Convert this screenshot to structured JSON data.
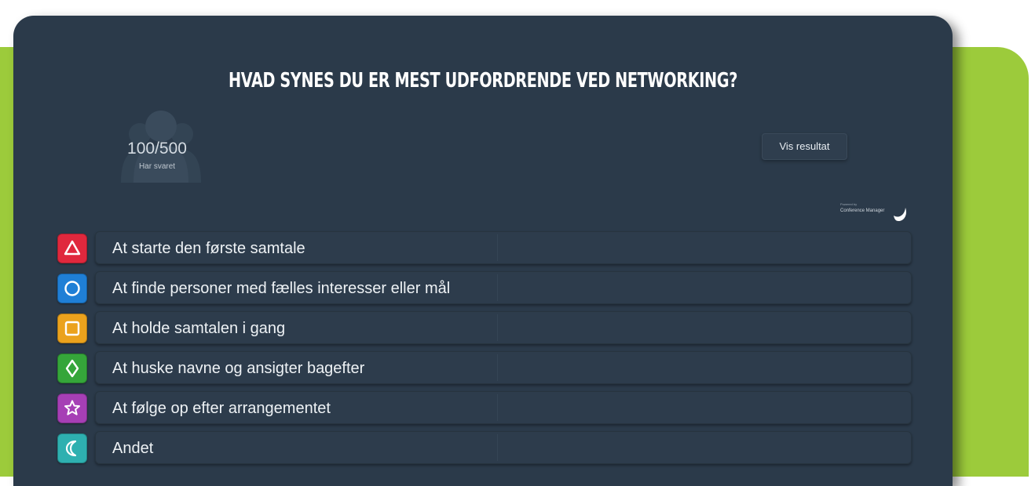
{
  "question": {
    "title": "HVAD SYNES DU ER MEST UDFORDRENDE VED NETWORKING?"
  },
  "stats": {
    "count": "100/500",
    "label": "Har svaret"
  },
  "actions": {
    "show_results": "Vis resultat"
  },
  "branding": {
    "powered_by": "Powered by",
    "product": "Conference Manager"
  },
  "colors": {
    "accent_green": "#9ccb3b",
    "panel": "#2b3a4a"
  },
  "answers": [
    {
      "label": "At starte den første samtale",
      "icon": "triangle-icon",
      "color": "#e0283d"
    },
    {
      "label": "At finde personer med fælles interesser eller mål",
      "icon": "circle-icon",
      "color": "#1f7fd6"
    },
    {
      "label": "At holde samtalen i gang",
      "icon": "square-icon",
      "color": "#eba21d"
    },
    {
      "label": "At huske navne og ansigter bagefter",
      "icon": "diamond-icon",
      "color": "#35a63a"
    },
    {
      "label": "At følge op efter arrangementet",
      "icon": "star-icon",
      "color": "#a63fb5"
    },
    {
      "label": "Andet",
      "icon": "moon-icon",
      "color": "#2eb0b0"
    }
  ]
}
